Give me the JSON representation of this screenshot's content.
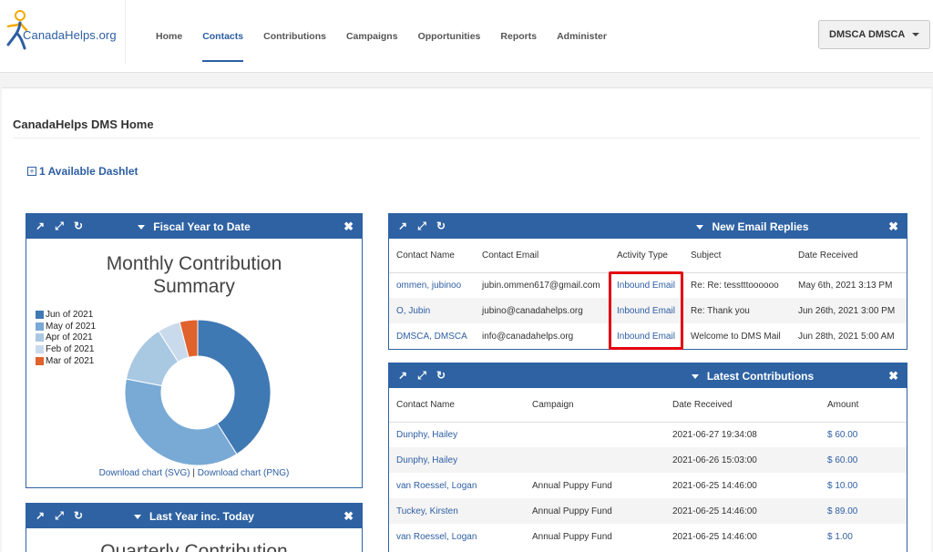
{
  "header": {
    "logo_text": "CanadaHelps.org",
    "nav": [
      {
        "label": "Home",
        "active": false
      },
      {
        "label": "Contacts",
        "active": true
      },
      {
        "label": "Contributions",
        "active": false
      },
      {
        "label": "Campaigns",
        "active": false
      },
      {
        "label": "Opportunities",
        "active": false
      },
      {
        "label": "Reports",
        "active": false
      },
      {
        "label": "Administer",
        "active": false
      }
    ],
    "user_button": "DMSCA DMSCA"
  },
  "page": {
    "title": "CanadaHelps DMS Home",
    "available_dashlet": "1 Available Dashlet"
  },
  "fiscal": {
    "title": "Fiscal Year to Date",
    "chart_data": {
      "type": "pie",
      "title": "Monthly Contribution Summary",
      "categories": [
        "Jun of 2021",
        "May of 2021",
        "Apr of 2021",
        "Feb of 2021",
        "Mar of 2021"
      ],
      "values": [
        41,
        37,
        13,
        5,
        4
      ],
      "colors": [
        "#3f79b4",
        "#79aad6",
        "#a9c8e2",
        "#c9daec",
        "#e0622c"
      ],
      "legend_position": "left"
    },
    "download_svg": "Download chart (SVG)",
    "download_sep": " | ",
    "download_png": "Download chart (PNG)"
  },
  "last_year": {
    "title": "Last Year inc. Today",
    "chart_title_partial": "Quarterly Contribution"
  },
  "email_replies": {
    "title": "New Email Replies",
    "columns": [
      "Contact Name",
      "Contact Email",
      "Activity Type",
      "Subject",
      "Date Received"
    ],
    "rows": [
      {
        "name": "ommen, jubinoo",
        "email": "jubin.ommen617@gmail.com",
        "type": "Inbound Email",
        "subject": "Re: Re: tesstttoooooo",
        "date": "May 6th, 2021 3:13 PM"
      },
      {
        "name": "O, Jubin",
        "email": "jubino@canadahelps.org",
        "type": "Inbound Email",
        "subject": "Re: Thank you",
        "date": "Jun 26th, 2021 3:00 PM"
      },
      {
        "name": "DMSCA, DMSCA",
        "email": "info@canadahelps.org",
        "type": "Inbound Email",
        "subject": "Welcome to DMS Mail",
        "date": "Jun 28th, 2021 5:00 AM"
      }
    ]
  },
  "contributions": {
    "title": "Latest Contributions",
    "columns": [
      "Contact Name",
      "Campaign",
      "Date Received",
      "Amount"
    ],
    "rows": [
      {
        "name": "Dunphy, Hailey",
        "campaign": "",
        "date": "2021-06-27 19:34:08",
        "amount": "$ 60.00"
      },
      {
        "name": "Dunphy, Hailey",
        "campaign": "",
        "date": "2021-06-26 15:03:00",
        "amount": "$ 60.00"
      },
      {
        "name": "van Roessel, Logan",
        "campaign": "Annual Puppy Fund",
        "date": "2021-06-25 14:46:00",
        "amount": "$ 10.00"
      },
      {
        "name": "Tuckey, Kirsten",
        "campaign": "Annual Puppy Fund",
        "date": "2021-06-25 14:46:00",
        "amount": "$ 89.00"
      },
      {
        "name": "van Roessel, Logan",
        "campaign": "Annual Puppy Fund",
        "date": "2021-06-25 14:46:00",
        "amount": "$ 1.00"
      }
    ]
  },
  "icons": {
    "popout": "external-link-icon",
    "expand": "expand-icon",
    "refresh": "refresh-icon",
    "close": "close-icon"
  }
}
